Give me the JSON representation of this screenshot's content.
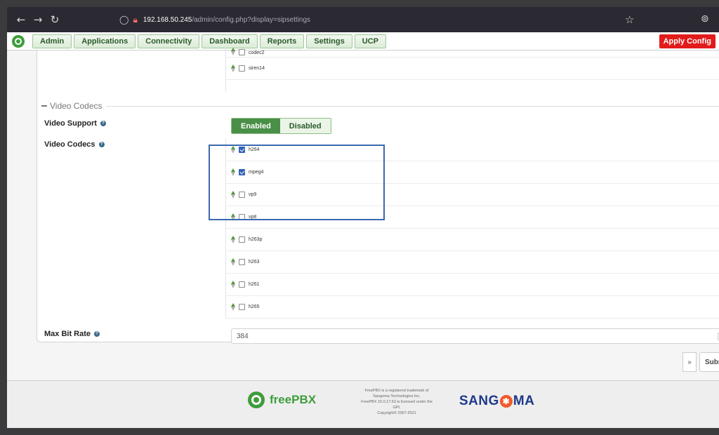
{
  "browser": {
    "back_icon": "arrow-left-icon",
    "forward_icon": "arrow-right-icon",
    "reload_icon": "reload-icon",
    "url_host": "192.168.50.245",
    "url_path": "/admin/config.php?display=sipsettings"
  },
  "nav": {
    "items": [
      {
        "label": "Admin"
      },
      {
        "label": "Applications"
      },
      {
        "label": "Connectivity"
      },
      {
        "label": "Dashboard"
      },
      {
        "label": "Reports"
      },
      {
        "label": "Settings"
      },
      {
        "label": "UCP"
      }
    ],
    "apply_config": "Apply Config"
  },
  "audio_codecs": [
    {
      "name": "codec2",
      "checked": false
    },
    {
      "name": "siren14",
      "checked": false
    }
  ],
  "video": {
    "section_title": "Video Codecs",
    "support_label": "Video Support",
    "codecs_label": "Video Codecs",
    "toggle": {
      "enabled": "Enabled",
      "disabled": "Disabled",
      "selected": "Enabled"
    },
    "codecs": [
      {
        "name": "h264",
        "checked": true
      },
      {
        "name": "mpeg4",
        "checked": true
      },
      {
        "name": "vp9",
        "checked": false
      },
      {
        "name": "vp8",
        "checked": false
      },
      {
        "name": "h263p",
        "checked": false
      },
      {
        "name": "h263",
        "checked": false
      },
      {
        "name": "h261",
        "checked": false
      },
      {
        "name": "h265",
        "checked": false
      }
    ],
    "max_bitrate_label": "Max Bit Rate",
    "max_bitrate_value": "384"
  },
  "actions": {
    "next_label": "»",
    "submit_label": "Subr"
  },
  "footer": {
    "freepbx_logo": "freePBX",
    "legal_lines": [
      "FreePBX is a registered trademark of",
      "Sangoma Technologies Inc.",
      "FreePBX 15.0.17.63 is licensed under the",
      "GPL",
      "Copyright© 2007-2021"
    ],
    "sangoma_logo": "SANGOMA"
  },
  "colors": {
    "accent_green": "#4a8f47",
    "apply_red": "#e21b1b",
    "checkbox_blue": "#2f63b8",
    "highlight_blue": "#3b68b0"
  }
}
